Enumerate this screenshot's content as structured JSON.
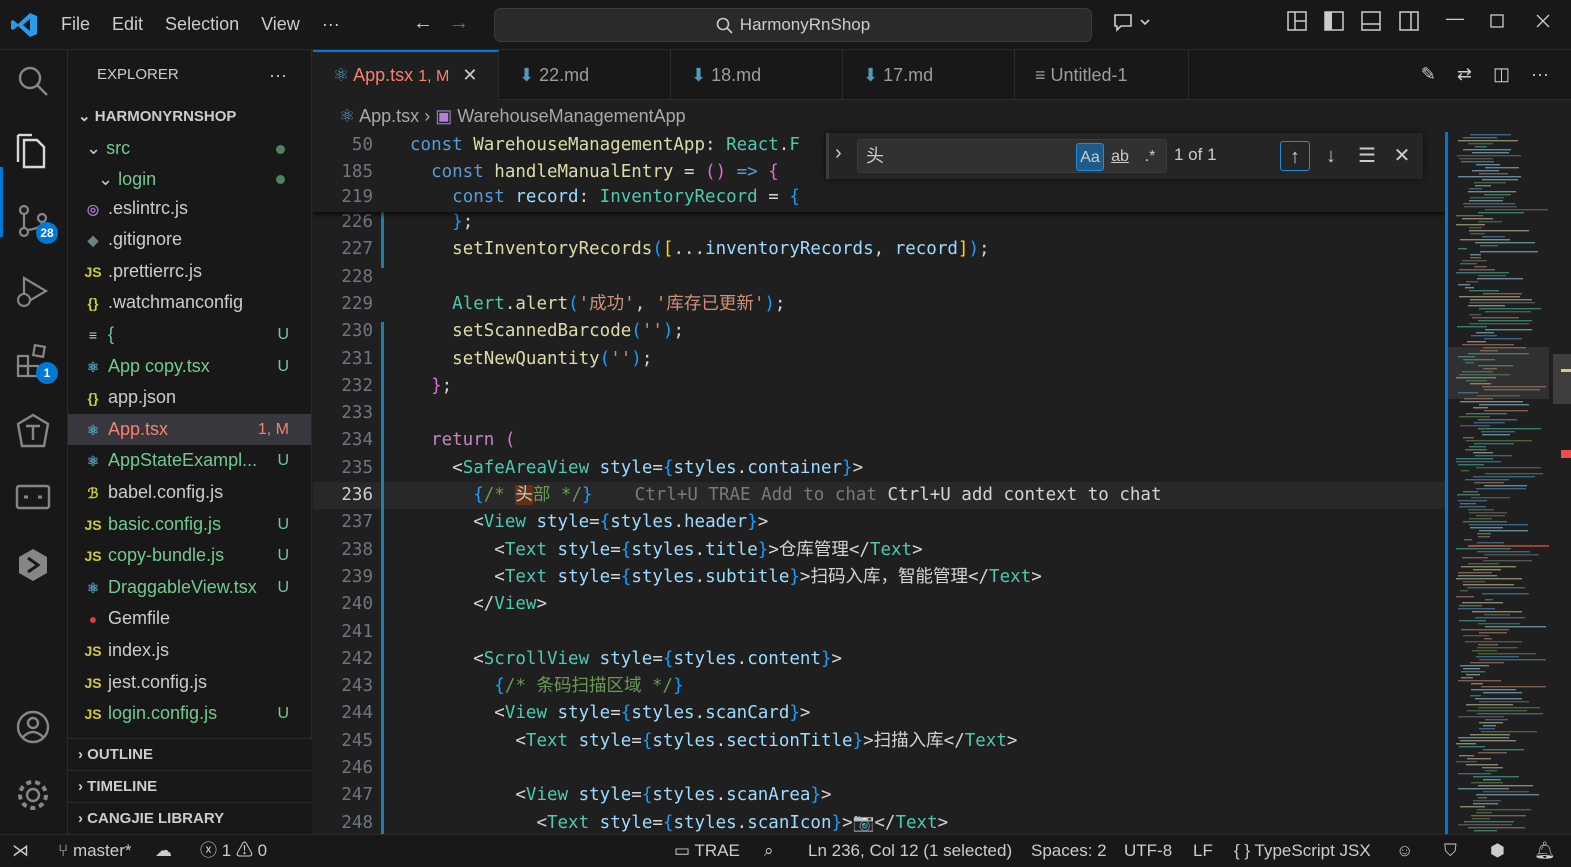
{
  "menu": [
    "File",
    "Edit",
    "Selection",
    "View",
    "···"
  ],
  "search": {
    "text": "HarmonyRnShop"
  },
  "activity_bar": {
    "scm_badge": "28",
    "extensions_badge": "1"
  },
  "explorer": {
    "title": "EXPLORER",
    "root": "HARMONYRNSHOP",
    "folders": [
      {
        "label": "src"
      },
      {
        "label": "login"
      }
    ],
    "files": [
      {
        "icon": "◎",
        "label": ".eslintrc.js",
        "status": "",
        "color": "#cccccc",
        "icon_color": "#a074c4"
      },
      {
        "icon": "◆",
        "label": ".gitignore",
        "status": "",
        "color": "#cccccc",
        "icon_color": "#6d8086"
      },
      {
        "icon": "JS",
        "label": ".prettierrc.js",
        "status": "",
        "color": "#cccccc",
        "icon_color": "#cbcb41"
      },
      {
        "icon": "{}",
        "label": ".watchmanconfig",
        "status": "",
        "color": "#cccccc",
        "icon_color": "#cbcb41"
      },
      {
        "icon": "≡",
        "label": "{",
        "status": "U",
        "color": "#73c991",
        "icon_color": "#cccccc"
      },
      {
        "icon": "⚛",
        "label": "App copy.tsx",
        "status": "U",
        "color": "#73c991",
        "icon_color": "#519aba"
      },
      {
        "icon": "{}",
        "label": "app.json",
        "status": "",
        "color": "#cccccc",
        "icon_color": "#cbcb41"
      },
      {
        "icon": "⚛",
        "label": "App.tsx",
        "status": "1, M",
        "color": "#f88070",
        "icon_color": "#519aba",
        "selected": true
      },
      {
        "icon": "⚛",
        "label": "AppStateExampl...",
        "status": "U",
        "color": "#73c991",
        "icon_color": "#519aba"
      },
      {
        "icon": "ℬ",
        "label": "babel.config.js",
        "status": "",
        "color": "#cccccc",
        "icon_color": "#cbcb41"
      },
      {
        "icon": "JS",
        "label": "basic.config.js",
        "status": "U",
        "color": "#73c991",
        "icon_color": "#cbcb41"
      },
      {
        "icon": "JS",
        "label": "copy-bundle.js",
        "status": "U",
        "color": "#73c991",
        "icon_color": "#cbcb41"
      },
      {
        "icon": "⚛",
        "label": "DraggableView.tsx",
        "status": "U",
        "color": "#73c991",
        "icon_color": "#519aba"
      },
      {
        "icon": "●",
        "label": "Gemfile",
        "status": "",
        "color": "#cccccc",
        "icon_color": "#e0383e"
      },
      {
        "icon": "JS",
        "label": "index.js",
        "status": "",
        "color": "#cccccc",
        "icon_color": "#cbcb41"
      },
      {
        "icon": "JS",
        "label": "jest.config.js",
        "status": "",
        "color": "#cccccc",
        "icon_color": "#cbcb41"
      },
      {
        "icon": "JS",
        "label": "login.config.js",
        "status": "U",
        "color": "#73c991",
        "icon_color": "#cbcb41"
      }
    ],
    "sections": [
      "OUTLINE",
      "TIMELINE",
      "CANGJIE LIBRARY"
    ]
  },
  "tabs": [
    {
      "label": "App.tsx",
      "badge": "1, M",
      "active": true
    },
    {
      "label": "22.md"
    },
    {
      "label": "18.md"
    },
    {
      "label": "17.md"
    },
    {
      "label": "Untitled-1"
    }
  ],
  "breadcrumb": {
    "file": "App.tsx",
    "symbol": "WarehouseManagementApp"
  },
  "find": {
    "query": "头",
    "match_case": "Aa",
    "whole_word": "ab",
    "regex": ".*",
    "count": "1 of 1"
  },
  "sticky_lines": [
    {
      "n": "50",
      "tokens": [
        [
          "kw",
          "const "
        ],
        [
          "fn",
          "WarehouseManagementApp"
        ],
        [
          "pun",
          ": "
        ],
        [
          "ty",
          "React"
        ],
        [
          "pun",
          "."
        ],
        [
          "ty",
          "F"
        ]
      ]
    },
    {
      "n": "185",
      "tokens": [
        [
          "pun",
          "  "
        ],
        [
          "kw",
          "const "
        ],
        [
          "fn",
          "handleManualEntry"
        ],
        [
          "pun",
          " = "
        ],
        [
          "br2",
          "()"
        ],
        [
          "kw",
          " => "
        ],
        [
          "br2",
          "{"
        ]
      ]
    },
    {
      "n": "219",
      "tokens": [
        [
          "pun",
          "    "
        ],
        [
          "kw",
          "const "
        ],
        [
          "var",
          "record"
        ],
        [
          "pun",
          ": "
        ],
        [
          "ty",
          "InventoryRecord"
        ],
        [
          "pun",
          " = "
        ],
        [
          "br3",
          "{"
        ]
      ]
    }
  ],
  "code_lines": [
    {
      "n": "226",
      "tokens": [
        [
          "pun",
          "    "
        ],
        [
          "br3",
          "}"
        ],
        [
          "pun",
          ";"
        ]
      ]
    },
    {
      "n": "227",
      "tokens": [
        [
          "pun",
          "    "
        ],
        [
          "fn",
          "setInventoryRecords"
        ],
        [
          "br3",
          "("
        ],
        [
          "br1",
          "["
        ],
        [
          "pun",
          "..."
        ],
        [
          "var",
          "inventoryRecords"
        ],
        [
          "pun",
          ", "
        ],
        [
          "var",
          "record"
        ],
        [
          "br1",
          "]"
        ],
        [
          "br3",
          ")"
        ],
        [
          "pun",
          ";"
        ]
      ]
    },
    {
      "n": "228",
      "tokens": []
    },
    {
      "n": "229",
      "tokens": [
        [
          "pun",
          "    "
        ],
        [
          "ty",
          "Alert"
        ],
        [
          "pun",
          "."
        ],
        [
          "fn",
          "alert"
        ],
        [
          "br3",
          "("
        ],
        [
          "str",
          "'成功'"
        ],
        [
          "pun",
          ", "
        ],
        [
          "str",
          "'库存已更新'"
        ],
        [
          "br3",
          ")"
        ],
        [
          "pun",
          ";"
        ]
      ]
    },
    {
      "n": "230",
      "tokens": [
        [
          "pun",
          "    "
        ],
        [
          "fn",
          "setScannedBarcode"
        ],
        [
          "br3",
          "("
        ],
        [
          "str",
          "''"
        ],
        [
          "br3",
          ")"
        ],
        [
          "pun",
          ";"
        ]
      ]
    },
    {
      "n": "231",
      "tokens": [
        [
          "pun",
          "    "
        ],
        [
          "fn",
          "setNewQuantity"
        ],
        [
          "br3",
          "("
        ],
        [
          "str",
          "''"
        ],
        [
          "br3",
          ")"
        ],
        [
          "pun",
          ";"
        ]
      ]
    },
    {
      "n": "232",
      "tokens": [
        [
          "pun",
          "  "
        ],
        [
          "br2",
          "}"
        ],
        [
          "pun",
          ";"
        ]
      ]
    },
    {
      "n": "233",
      "tokens": []
    },
    {
      "n": "234",
      "tokens": [
        [
          "pun",
          "  "
        ],
        [
          "kw2",
          "return "
        ],
        [
          "br2",
          "("
        ]
      ]
    },
    {
      "n": "235",
      "tokens": [
        [
          "pun",
          "    "
        ],
        [
          "pun",
          "<"
        ],
        [
          "tag",
          "SafeAreaView"
        ],
        [
          "var",
          " style"
        ],
        [
          "pun",
          "="
        ],
        [
          "br3",
          "{"
        ],
        [
          "var",
          "styles"
        ],
        [
          "pun",
          "."
        ],
        [
          "var",
          "container"
        ],
        [
          "br3",
          "}"
        ],
        [
          "pun",
          ">"
        ]
      ]
    },
    {
      "n": "236",
      "current": true,
      "tokens": [
        [
          "pun",
          "      "
        ],
        [
          "br3",
          "{"
        ],
        [
          "cm",
          "/* "
        ],
        [
          "hl",
          "头"
        ],
        [
          "cm",
          "部 */"
        ],
        [
          "br3",
          "}"
        ],
        [
          "ghost",
          "    Ctrl+U TRAE Add to chat "
        ],
        [
          "pun",
          "Ctrl+U add context to chat"
        ]
      ]
    },
    {
      "n": "237",
      "tokens": [
        [
          "pun",
          "      "
        ],
        [
          "pun",
          "<"
        ],
        [
          "tag",
          "View"
        ],
        [
          "var",
          " style"
        ],
        [
          "pun",
          "="
        ],
        [
          "br3",
          "{"
        ],
        [
          "var",
          "styles"
        ],
        [
          "pun",
          "."
        ],
        [
          "var",
          "header"
        ],
        [
          "br3",
          "}"
        ],
        [
          "pun",
          ">"
        ]
      ]
    },
    {
      "n": "238",
      "tokens": [
        [
          "pun",
          "        "
        ],
        [
          "pun",
          "<"
        ],
        [
          "tag",
          "Text"
        ],
        [
          "var",
          " style"
        ],
        [
          "pun",
          "="
        ],
        [
          "br3",
          "{"
        ],
        [
          "var",
          "styles"
        ],
        [
          "pun",
          "."
        ],
        [
          "var",
          "title"
        ],
        [
          "br3",
          "}"
        ],
        [
          "pun",
          ">仓库管理</"
        ],
        [
          "tag",
          "Text"
        ],
        [
          "pun",
          ">"
        ]
      ]
    },
    {
      "n": "239",
      "tokens": [
        [
          "pun",
          "        "
        ],
        [
          "pun",
          "<"
        ],
        [
          "tag",
          "Text"
        ],
        [
          "var",
          " style"
        ],
        [
          "pun",
          "="
        ],
        [
          "br3",
          "{"
        ],
        [
          "var",
          "styles"
        ],
        [
          "pun",
          "."
        ],
        [
          "var",
          "subtitle"
        ],
        [
          "br3",
          "}"
        ],
        [
          "pun",
          ">扫码入库，智能管理</"
        ],
        [
          "tag",
          "Text"
        ],
        [
          "pun",
          ">"
        ]
      ]
    },
    {
      "n": "240",
      "tokens": [
        [
          "pun",
          "      </"
        ],
        [
          "tag",
          "View"
        ],
        [
          "pun",
          ">"
        ]
      ]
    },
    {
      "n": "241",
      "tokens": []
    },
    {
      "n": "242",
      "tokens": [
        [
          "pun",
          "      "
        ],
        [
          "pun",
          "<"
        ],
        [
          "tag",
          "ScrollView"
        ],
        [
          "var",
          " style"
        ],
        [
          "pun",
          "="
        ],
        [
          "br3",
          "{"
        ],
        [
          "var",
          "styles"
        ],
        [
          "pun",
          "."
        ],
        [
          "var",
          "content"
        ],
        [
          "br3",
          "}"
        ],
        [
          "pun",
          ">"
        ]
      ]
    },
    {
      "n": "243",
      "tokens": [
        [
          "pun",
          "        "
        ],
        [
          "br3",
          "{"
        ],
        [
          "cm",
          "/* 条码扫描区域 */"
        ],
        [
          "br3",
          "}"
        ]
      ]
    },
    {
      "n": "244",
      "tokens": [
        [
          "pun",
          "        "
        ],
        [
          "pun",
          "<"
        ],
        [
          "tag",
          "View"
        ],
        [
          "var",
          " style"
        ],
        [
          "pun",
          "="
        ],
        [
          "br3",
          "{"
        ],
        [
          "var",
          "styles"
        ],
        [
          "pun",
          "."
        ],
        [
          "var",
          "scanCard"
        ],
        [
          "br3",
          "}"
        ],
        [
          "pun",
          ">"
        ]
      ]
    },
    {
      "n": "245",
      "tokens": [
        [
          "pun",
          "          "
        ],
        [
          "pun",
          "<"
        ],
        [
          "tag",
          "Text"
        ],
        [
          "var",
          " style"
        ],
        [
          "pun",
          "="
        ],
        [
          "br3",
          "{"
        ],
        [
          "var",
          "styles"
        ],
        [
          "pun",
          "."
        ],
        [
          "var",
          "sectionTitle"
        ],
        [
          "br3",
          "}"
        ],
        [
          "pun",
          ">扫描入库</"
        ],
        [
          "tag",
          "Text"
        ],
        [
          "pun",
          ">"
        ]
      ]
    },
    {
      "n": "246",
      "tokens": []
    },
    {
      "n": "247",
      "tokens": [
        [
          "pun",
          "          "
        ],
        [
          "pun",
          "<"
        ],
        [
          "tag",
          "View"
        ],
        [
          "var",
          " style"
        ],
        [
          "pun",
          "="
        ],
        [
          "br3",
          "{"
        ],
        [
          "var",
          "styles"
        ],
        [
          "pun",
          "."
        ],
        [
          "var",
          "scanArea"
        ],
        [
          "br3",
          "}"
        ],
        [
          "pun",
          ">"
        ]
      ]
    },
    {
      "n": "248",
      "tokens": [
        [
          "pun",
          "            "
        ],
        [
          "pun",
          "<"
        ],
        [
          "tag",
          "Text"
        ],
        [
          "var",
          " style"
        ],
        [
          "pun",
          "="
        ],
        [
          "br3",
          "{"
        ],
        [
          "var",
          "styles"
        ],
        [
          "pun",
          "."
        ],
        [
          "var",
          "scanIcon"
        ],
        [
          "br3",
          "}"
        ],
        [
          "pun",
          ">📷</"
        ],
        [
          "tag",
          "Text"
        ],
        [
          "pun",
          ">"
        ]
      ]
    }
  ],
  "status": {
    "branch": "master*",
    "errors": "1",
    "warnings": "0",
    "trae": "TRAE",
    "cursor": "Ln 236, Col 12 (1 selected)",
    "spaces": "Spaces: 2",
    "encoding": "UTF-8",
    "eol": "LF",
    "language": "TypeScript JSX"
  }
}
